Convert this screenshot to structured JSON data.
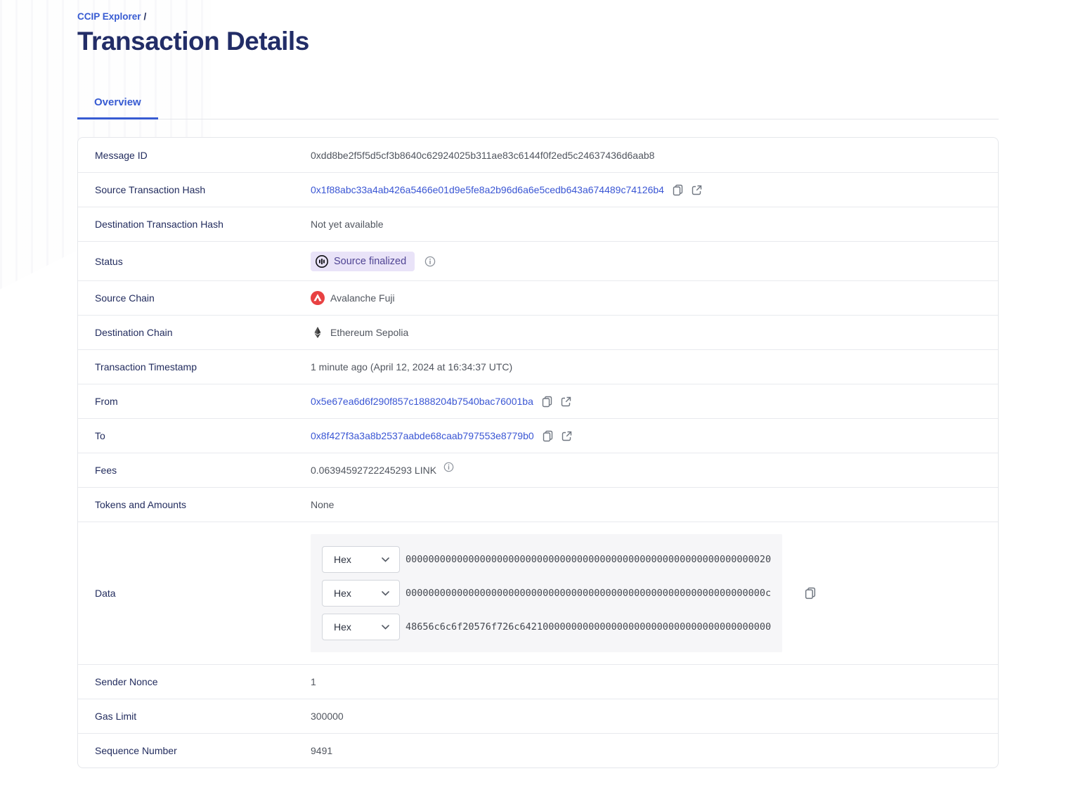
{
  "breadcrumb": {
    "link_label": "CCIP Explorer",
    "separator": "/"
  },
  "page_title": "Transaction Details",
  "tabs": {
    "overview_label": "Overview"
  },
  "colors": {
    "accent_blue": "#375BD2",
    "badge_bg": "#E9E3F8",
    "badge_text": "#4F4493",
    "avalanche_red": "#E84142",
    "title_navy": "#222D67"
  },
  "rows": {
    "message_id": {
      "label": "Message ID",
      "value": "0xdd8be2f5f5d5cf3b8640c62924025b311ae83c6144f0f2ed5c24637436d6aab8"
    },
    "source_tx_hash": {
      "label": "Source Transaction Hash",
      "value": "0x1f88abc33a4ab426a5466e01d9e5fe8a2b96d6a6e5cedb643a674489c74126b4"
    },
    "dest_tx_hash": {
      "label": "Destination Transaction Hash",
      "value": "Not yet available"
    },
    "status": {
      "label": "Status",
      "badge_label": "Source finalized"
    },
    "source_chain": {
      "label": "Source Chain",
      "value": "Avalanche Fuji"
    },
    "dest_chain": {
      "label": "Destination Chain",
      "value": "Ethereum Sepolia"
    },
    "timestamp": {
      "label": "Transaction Timestamp",
      "value": "1 minute ago (April 12, 2024 at 16:34:37 UTC)"
    },
    "from": {
      "label": "From",
      "value": "0x5e67ea6d6f290f857c1888204b7540bac76001ba"
    },
    "to": {
      "label": "To",
      "value": "0x8f427f3a3a8b2537aabde68caab797553e8779b0"
    },
    "fees": {
      "label": "Fees",
      "value": "0.06394592722245293 LINK"
    },
    "tokens_and_amounts": {
      "label": "Tokens and Amounts",
      "value": "None"
    },
    "data": {
      "label": "Data",
      "encoding_selected": "Hex",
      "lines": [
        "0000000000000000000000000000000000000000000000000000000000000020",
        "000000000000000000000000000000000000000000000000000000000000000c",
        "48656c6c6f20576f726c64210000000000000000000000000000000000000000"
      ]
    },
    "sender_nonce": {
      "label": "Sender Nonce",
      "value": "1"
    },
    "gas_limit": {
      "label": "Gas Limit",
      "value": "300000"
    },
    "sequence_number": {
      "label": "Sequence Number",
      "value": "9491"
    }
  }
}
